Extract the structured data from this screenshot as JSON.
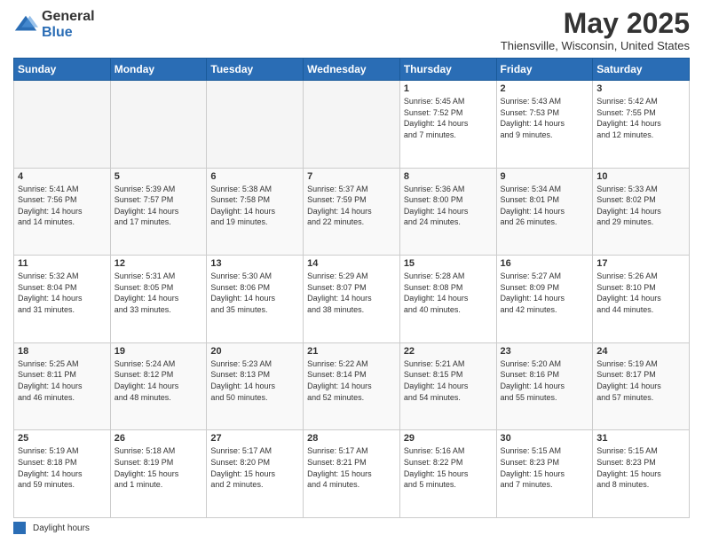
{
  "logo": {
    "general": "General",
    "blue": "Blue"
  },
  "title": "May 2025",
  "location": "Thiensville, Wisconsin, United States",
  "days_of_week": [
    "Sunday",
    "Monday",
    "Tuesday",
    "Wednesday",
    "Thursday",
    "Friday",
    "Saturday"
  ],
  "footer": {
    "legend_label": "Daylight hours"
  },
  "weeks": [
    [
      {
        "day": "",
        "info": ""
      },
      {
        "day": "",
        "info": ""
      },
      {
        "day": "",
        "info": ""
      },
      {
        "day": "",
        "info": ""
      },
      {
        "day": "1",
        "info": "Sunrise: 5:45 AM\nSunset: 7:52 PM\nDaylight: 14 hours\nand 7 minutes."
      },
      {
        "day": "2",
        "info": "Sunrise: 5:43 AM\nSunset: 7:53 PM\nDaylight: 14 hours\nand 9 minutes."
      },
      {
        "day": "3",
        "info": "Sunrise: 5:42 AM\nSunset: 7:55 PM\nDaylight: 14 hours\nand 12 minutes."
      }
    ],
    [
      {
        "day": "4",
        "info": "Sunrise: 5:41 AM\nSunset: 7:56 PM\nDaylight: 14 hours\nand 14 minutes."
      },
      {
        "day": "5",
        "info": "Sunrise: 5:39 AM\nSunset: 7:57 PM\nDaylight: 14 hours\nand 17 minutes."
      },
      {
        "day": "6",
        "info": "Sunrise: 5:38 AM\nSunset: 7:58 PM\nDaylight: 14 hours\nand 19 minutes."
      },
      {
        "day": "7",
        "info": "Sunrise: 5:37 AM\nSunset: 7:59 PM\nDaylight: 14 hours\nand 22 minutes."
      },
      {
        "day": "8",
        "info": "Sunrise: 5:36 AM\nSunset: 8:00 PM\nDaylight: 14 hours\nand 24 minutes."
      },
      {
        "day": "9",
        "info": "Sunrise: 5:34 AM\nSunset: 8:01 PM\nDaylight: 14 hours\nand 26 minutes."
      },
      {
        "day": "10",
        "info": "Sunrise: 5:33 AM\nSunset: 8:02 PM\nDaylight: 14 hours\nand 29 minutes."
      }
    ],
    [
      {
        "day": "11",
        "info": "Sunrise: 5:32 AM\nSunset: 8:04 PM\nDaylight: 14 hours\nand 31 minutes."
      },
      {
        "day": "12",
        "info": "Sunrise: 5:31 AM\nSunset: 8:05 PM\nDaylight: 14 hours\nand 33 minutes."
      },
      {
        "day": "13",
        "info": "Sunrise: 5:30 AM\nSunset: 8:06 PM\nDaylight: 14 hours\nand 35 minutes."
      },
      {
        "day": "14",
        "info": "Sunrise: 5:29 AM\nSunset: 8:07 PM\nDaylight: 14 hours\nand 38 minutes."
      },
      {
        "day": "15",
        "info": "Sunrise: 5:28 AM\nSunset: 8:08 PM\nDaylight: 14 hours\nand 40 minutes."
      },
      {
        "day": "16",
        "info": "Sunrise: 5:27 AM\nSunset: 8:09 PM\nDaylight: 14 hours\nand 42 minutes."
      },
      {
        "day": "17",
        "info": "Sunrise: 5:26 AM\nSunset: 8:10 PM\nDaylight: 14 hours\nand 44 minutes."
      }
    ],
    [
      {
        "day": "18",
        "info": "Sunrise: 5:25 AM\nSunset: 8:11 PM\nDaylight: 14 hours\nand 46 minutes."
      },
      {
        "day": "19",
        "info": "Sunrise: 5:24 AM\nSunset: 8:12 PM\nDaylight: 14 hours\nand 48 minutes."
      },
      {
        "day": "20",
        "info": "Sunrise: 5:23 AM\nSunset: 8:13 PM\nDaylight: 14 hours\nand 50 minutes."
      },
      {
        "day": "21",
        "info": "Sunrise: 5:22 AM\nSunset: 8:14 PM\nDaylight: 14 hours\nand 52 minutes."
      },
      {
        "day": "22",
        "info": "Sunrise: 5:21 AM\nSunset: 8:15 PM\nDaylight: 14 hours\nand 54 minutes."
      },
      {
        "day": "23",
        "info": "Sunrise: 5:20 AM\nSunset: 8:16 PM\nDaylight: 14 hours\nand 55 minutes."
      },
      {
        "day": "24",
        "info": "Sunrise: 5:19 AM\nSunset: 8:17 PM\nDaylight: 14 hours\nand 57 minutes."
      }
    ],
    [
      {
        "day": "25",
        "info": "Sunrise: 5:19 AM\nSunset: 8:18 PM\nDaylight: 14 hours\nand 59 minutes."
      },
      {
        "day": "26",
        "info": "Sunrise: 5:18 AM\nSunset: 8:19 PM\nDaylight: 15 hours\nand 1 minute."
      },
      {
        "day": "27",
        "info": "Sunrise: 5:17 AM\nSunset: 8:20 PM\nDaylight: 15 hours\nand 2 minutes."
      },
      {
        "day": "28",
        "info": "Sunrise: 5:17 AM\nSunset: 8:21 PM\nDaylight: 15 hours\nand 4 minutes."
      },
      {
        "day": "29",
        "info": "Sunrise: 5:16 AM\nSunset: 8:22 PM\nDaylight: 15 hours\nand 5 minutes."
      },
      {
        "day": "30",
        "info": "Sunrise: 5:15 AM\nSunset: 8:23 PM\nDaylight: 15 hours\nand 7 minutes."
      },
      {
        "day": "31",
        "info": "Sunrise: 5:15 AM\nSunset: 8:23 PM\nDaylight: 15 hours\nand 8 minutes."
      }
    ]
  ]
}
